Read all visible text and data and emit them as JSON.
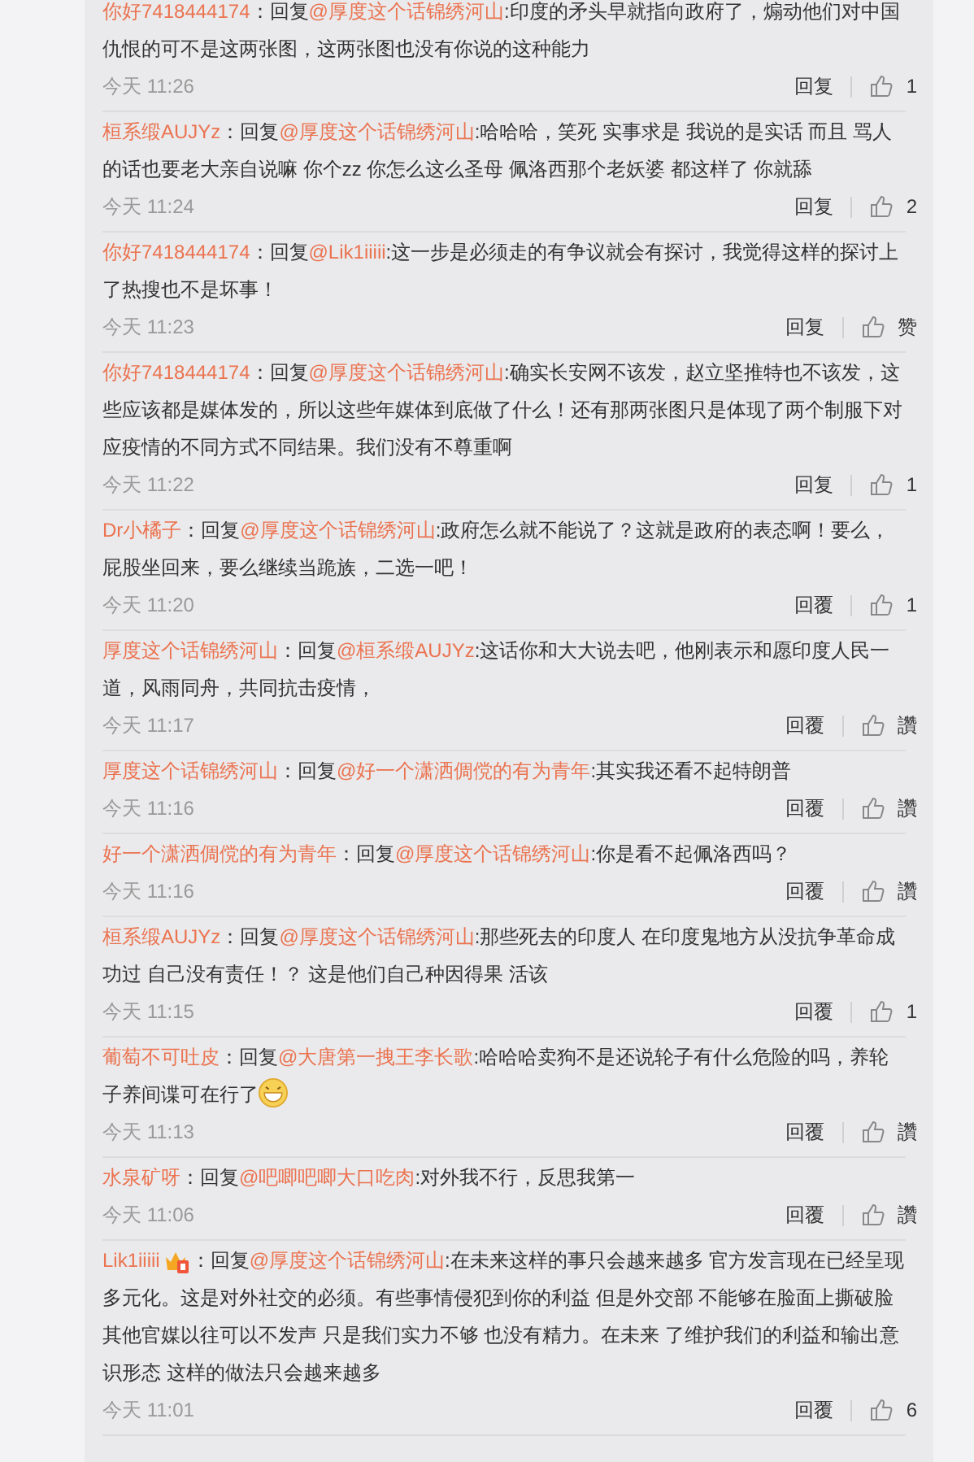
{
  "comments": [
    {
      "user": "你好7418444174",
      "badge": false,
      "colon": "：",
      "reply_prefix": "回复",
      "mention": "@厚度这个话锦绣河山",
      "text": ":印度的矛头早就指向政府了，煽动他们对中国仇恨的可不是这两张图，这两张图也没有你说的这种能力",
      "emoji": false,
      "time": "今天 11:26",
      "reply_button": "回复",
      "likes": "1"
    },
    {
      "user": "桓系缎AUJYz",
      "badge": false,
      "colon": "：",
      "reply_prefix": "回复",
      "mention": "@厚度这个话锦绣河山",
      "text": ":哈哈哈，笑死 实事求是 我说的是实话 而且 骂人的话也要老大亲自说嘛 你个zz 你怎么这么圣母  佩洛西那个老妖婆  都这样了  你就舔",
      "emoji": false,
      "time": "今天 11:24",
      "reply_button": "回复",
      "likes": "2"
    },
    {
      "user": "你好7418444174",
      "badge": false,
      "colon": "：",
      "reply_prefix": "回复",
      "mention": "@Lik1iiiii",
      "text": ":这一步是必须走的有争议就会有探讨，我觉得这样的探讨上了热搜也不是坏事！",
      "emoji": false,
      "time": "今天 11:23",
      "reply_button": "回复",
      "likes": "赞"
    },
    {
      "user": "你好7418444174",
      "badge": false,
      "colon": "：",
      "reply_prefix": "回复",
      "mention": "@厚度这个话锦绣河山",
      "text": ":确实长安网不该发，赵立坚推特也不该发，这些应该都是媒体发的，所以这些年媒体到底做了什么！还有那两张图只是体现了两个制服下对应疫情的不同方式不同结果。我们没有不尊重啊",
      "emoji": false,
      "time": "今天 11:22",
      "reply_button": "回复",
      "likes": "1"
    },
    {
      "user": "Dr小橘子",
      "badge": false,
      "colon": "：",
      "reply_prefix": "回复",
      "mention": "@厚度这个话锦绣河山",
      "text": ":政府怎么就不能说了？这就是政府的表态啊！要么，屁股坐回来，要么继续当跪族，二选一吧！",
      "emoji": false,
      "time": "今天 11:20",
      "reply_button": "回覆",
      "likes": "1"
    },
    {
      "user": "厚度这个话锦绣河山",
      "badge": false,
      "colon": "：",
      "reply_prefix": "回复",
      "mention": "@桓系缎AUJYz",
      "text": ":这话你和大大说去吧，他刚表示和愿印度人民一道，风雨同舟，共同抗击疫情，",
      "emoji": false,
      "time": "今天 11:17",
      "reply_button": "回覆",
      "likes": "讚"
    },
    {
      "user": "厚度这个话锦绣河山",
      "badge": false,
      "colon": "：",
      "reply_prefix": "回复",
      "mention": "@好一个潇洒倜傥的有为青年",
      "text": ":其实我还看不起特朗普",
      "emoji": false,
      "time": "今天 11:16",
      "reply_button": "回覆",
      "likes": "讚"
    },
    {
      "user": "好一个潇洒倜傥的有为青年",
      "badge": false,
      "colon": "：",
      "reply_prefix": "回复",
      "mention": "@厚度这个话锦绣河山",
      "text": ":你是看不起佩洛西吗？",
      "emoji": false,
      "time": "今天 11:16",
      "reply_button": "回覆",
      "likes": "讚"
    },
    {
      "user": "桓系缎AUJYz",
      "badge": false,
      "colon": "：",
      "reply_prefix": "回复",
      "mention": "@厚度这个话锦绣河山",
      "text": ":那些死去的印度人 在印度鬼地方从没抗争革命成功过 自己没有责任！？ 这是他们自己种因得果 活该",
      "emoji": false,
      "time": "今天 11:15",
      "reply_button": "回覆",
      "likes": "1"
    },
    {
      "user": "葡萄不可吐皮",
      "badge": false,
      "colon": "：",
      "reply_prefix": "回复",
      "mention": "@大唐第一拽王李长歌",
      "text": ":哈哈哈卖狗不是还说轮子有什么危险的吗，养轮子养间谍可在行了",
      "emoji": true,
      "time": "今天 11:13",
      "reply_button": "回覆",
      "likes": "讚"
    },
    {
      "user": "水泉矿呀",
      "badge": false,
      "colon": "：",
      "reply_prefix": "回复",
      "mention": "@吧唧吧唧大口吃肉",
      "text": ":对外我不行，反思我第一",
      "emoji": false,
      "time": "今天 11:06",
      "reply_button": "回覆",
      "likes": "讚"
    },
    {
      "user": "Lik1iiiii",
      "badge": true,
      "colon": "：",
      "reply_prefix": "回复",
      "mention": "@厚度这个话锦绣河山",
      "text": ":在未来这样的事只会越来越多 官方发言现在已经呈现多元化。这是对外社交的必须。有些事情侵犯到你的利益 但是外交部 不能够在脸面上撕破脸其他官媒以往可以不发声 只是我们实力不够 也没有精力。在未来 了维护我们的利益和输出意识形态  这样的做法只会越来越多",
      "emoji": false,
      "time": "今天 11:01",
      "reply_button": "回覆",
      "likes": "6"
    }
  ]
}
